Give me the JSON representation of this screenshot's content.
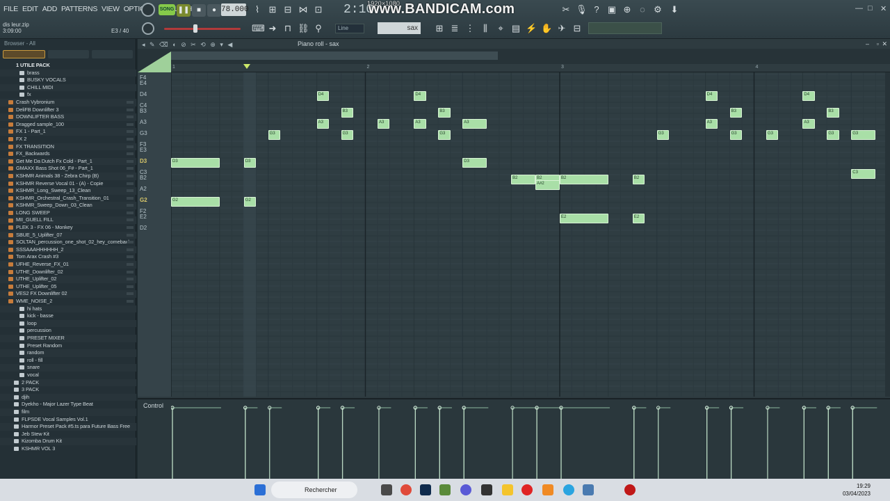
{
  "menu": [
    "FILE",
    "EDIT",
    "ADD",
    "PATTERNS",
    "VIEW",
    "OPTIONS",
    "TOOLS",
    "HELP"
  ],
  "transport": {
    "song_label": "SONG",
    "tempo": "78.000",
    "time": "2:10",
    "watermark": "www.BANDICAM.com",
    "resolution": "1920×1080"
  },
  "hint": {
    "file": "dis leur.zip",
    "time": "3:09:00",
    "position": "E3 / 40"
  },
  "snap": "Line",
  "instrument": "sax",
  "browser": {
    "title": "Browser - All",
    "items": [
      {
        "label": "1 UTILE PACK",
        "kind": "pack"
      },
      {
        "label": "brass",
        "kind": "folder",
        "indent": 2
      },
      {
        "label": "BUSKY VOCALS",
        "kind": "folder",
        "indent": 2
      },
      {
        "label": "CHILL MIDI",
        "kind": "folder",
        "indent": 2
      },
      {
        "label": "fx",
        "kind": "folder",
        "indent": 2
      },
      {
        "label": "Crash Vybronium",
        "kind": "file"
      },
      {
        "label": "DeliFB Downlifter 3",
        "kind": "file"
      },
      {
        "label": "DOWNLIFTER BASS",
        "kind": "file"
      },
      {
        "label": "Dragged sample_100",
        "kind": "file"
      },
      {
        "label": "FX 1 - Part_1",
        "kind": "file"
      },
      {
        "label": "FX 2",
        "kind": "file"
      },
      {
        "label": "FX TRANSITION",
        "kind": "file"
      },
      {
        "label": "FX_Backwards",
        "kind": "file"
      },
      {
        "label": "Get Me Da Dutch Fx Cold - Part_1",
        "kind": "file"
      },
      {
        "label": "GMAXX Bass Shot 06_F# - Part_1",
        "kind": "file"
      },
      {
        "label": "KSHMR Animals 38 - Zebra Chirp (B)",
        "kind": "file"
      },
      {
        "label": "KSHMR Reverse Vocal 01 - (A) - Copie",
        "kind": "file"
      },
      {
        "label": "KSHMR_Long_Sweep_13_Clean",
        "kind": "file",
        "selected": true
      },
      {
        "label": "KSHMR_Orchestral_Crash_Transition_01",
        "kind": "file"
      },
      {
        "label": "KSHMR_Sweep_Down_03_Clean",
        "kind": "file"
      },
      {
        "label": "LONG SWEEP",
        "kind": "file"
      },
      {
        "label": "MII_GUELL FILL",
        "kind": "file"
      },
      {
        "label": "PLEK 3 - FX 06 - Monkey",
        "kind": "file"
      },
      {
        "label": "SBUE_5_Uplifter_07",
        "kind": "file"
      },
      {
        "label": "SOLTAN_percussion_one_shot_02_hey_comeback",
        "kind": "file"
      },
      {
        "label": "SSSAAAHHHHHH_2",
        "kind": "file"
      },
      {
        "label": "Tom Arax Crash #3",
        "kind": "file"
      },
      {
        "label": "UFHE_Reverse_FX_01",
        "kind": "file"
      },
      {
        "label": "UTHE_Downlifter_02",
        "kind": "file"
      },
      {
        "label": "UTHE_Uplifter_02",
        "kind": "file"
      },
      {
        "label": "UTHE_Uplifter_05",
        "kind": "file"
      },
      {
        "label": "VES2 FX Downlifter 02",
        "kind": "file"
      },
      {
        "label": "WME_NOISE_2",
        "kind": "file"
      },
      {
        "label": "hi hats",
        "kind": "folder",
        "indent": 2
      },
      {
        "label": "kick - basse",
        "kind": "folder",
        "indent": 2
      },
      {
        "label": "loop",
        "kind": "folder",
        "indent": 2
      },
      {
        "label": "percussion",
        "kind": "folder",
        "indent": 2
      },
      {
        "label": "PRESET MIXER",
        "kind": "folder",
        "indent": 2
      },
      {
        "label": "Preset Random",
        "kind": "folder",
        "indent": 2
      },
      {
        "label": "random",
        "kind": "folder",
        "indent": 2
      },
      {
        "label": "roll - fill",
        "kind": "folder",
        "indent": 2
      },
      {
        "label": "snare",
        "kind": "folder",
        "indent": 2
      },
      {
        "label": "vocal",
        "kind": "folder",
        "indent": 2
      },
      {
        "label": "2 PACK",
        "kind": "folder",
        "indent": 1
      },
      {
        "label": "3 PACK",
        "kind": "folder",
        "indent": 1
      },
      {
        "label": "djih",
        "kind": "folder",
        "indent": 1
      },
      {
        "label": "Dyekho - Major Lazer Type Beat",
        "kind": "folder",
        "indent": 1
      },
      {
        "label": "film",
        "kind": "folder",
        "indent": 1
      },
      {
        "label": "FLPSDE Vocal Samples Vol.1",
        "kind": "folder",
        "indent": 1
      },
      {
        "label": "Harmor Preset Pack #5.ts para Future Bass Free",
        "kind": "folder",
        "indent": 1
      },
      {
        "label": "Jeb Stew Kit",
        "kind": "folder",
        "indent": 1
      },
      {
        "label": "Kizomba Drum Kit",
        "kind": "folder",
        "indent": 1
      },
      {
        "label": "KSHMR VOL 3",
        "kind": "folder",
        "indent": 1
      }
    ]
  },
  "piano_roll": {
    "title": "Piano roll - sax",
    "bars": [
      "1",
      "2",
      "3",
      "4"
    ],
    "keys": [
      {
        "name": "F4"
      },
      {
        "name": "E4"
      },
      {
        "name": "D4"
      },
      {
        "name": "C4"
      },
      {
        "name": "B3"
      },
      {
        "name": "A3"
      },
      {
        "name": "G3"
      },
      {
        "name": "F3"
      },
      {
        "name": "E3"
      },
      {
        "name": "D3",
        "highlight": true
      },
      {
        "name": "C3"
      },
      {
        "name": "B2"
      },
      {
        "name": "A2"
      },
      {
        "name": "G2",
        "highlight": true
      },
      {
        "name": "F2"
      },
      {
        "name": "E2"
      },
      {
        "name": "D2"
      }
    ],
    "notes": [
      {
        "pitch": "D3",
        "start": 1.0,
        "length": 0.25
      },
      {
        "pitch": "G2",
        "start": 1.0,
        "length": 0.25
      },
      {
        "pitch": "D3",
        "start": 1.375,
        "length": 0.0625
      },
      {
        "pitch": "G2",
        "start": 1.375,
        "length": 0.0625
      },
      {
        "pitch": "G3",
        "start": 1.5,
        "length": 0.0625
      },
      {
        "pitch": "A3",
        "start": 1.75,
        "length": 0.0625
      },
      {
        "pitch": "D4",
        "start": 1.75,
        "length": 0.0625
      },
      {
        "pitch": "B3",
        "start": 1.875,
        "length": 0.0625
      },
      {
        "pitch": "G3",
        "start": 1.875,
        "length": 0.0625
      },
      {
        "pitch": "A3",
        "start": 2.0625,
        "length": 0.0625
      },
      {
        "pitch": "A3",
        "start": 2.25,
        "length": 0.0625
      },
      {
        "pitch": "D4",
        "start": 2.25,
        "length": 0.0625
      },
      {
        "pitch": "B3",
        "start": 2.375,
        "length": 0.0625
      },
      {
        "pitch": "G3",
        "start": 2.375,
        "length": 0.0625
      },
      {
        "pitch": "A3",
        "start": 2.5,
        "length": 0.125
      },
      {
        "pitch": "D3",
        "start": 2.5,
        "length": 0.125
      },
      {
        "pitch": "B2",
        "start": 2.75,
        "length": 0.125
      },
      {
        "pitch": "B2",
        "start": 2.875,
        "length": 0.125
      },
      {
        "pitch": "A#2",
        "start": 2.875,
        "length": 0.125
      },
      {
        "pitch": "B2",
        "start": 3.0,
        "length": 0.25
      },
      {
        "pitch": "E2",
        "start": 3.0,
        "length": 0.25
      },
      {
        "pitch": "B2",
        "start": 3.375,
        "length": 0.0625
      },
      {
        "pitch": "E2",
        "start": 3.375,
        "length": 0.0625
      },
      {
        "pitch": "G3",
        "start": 3.5,
        "length": 0.0625
      },
      {
        "pitch": "A3",
        "start": 3.75,
        "length": 0.0625
      },
      {
        "pitch": "D4",
        "start": 3.75,
        "length": 0.0625
      },
      {
        "pitch": "B3",
        "start": 3.875,
        "length": 0.0625
      },
      {
        "pitch": "G3",
        "start": 3.875,
        "length": 0.0625
      },
      {
        "pitch": "G3",
        "start": 4.0625,
        "length": 0.0625
      },
      {
        "pitch": "A3",
        "start": 4.25,
        "length": 0.0625
      },
      {
        "pitch": "D4",
        "start": 4.25,
        "length": 0.0625
      },
      {
        "pitch": "B3",
        "start": 4.375,
        "length": 0.0625
      },
      {
        "pitch": "G3",
        "start": 4.375,
        "length": 0.0625
      },
      {
        "pitch": "G3",
        "start": 4.5,
        "length": 0.125
      },
      {
        "pitch": "C3",
        "start": 4.5,
        "length": 0.125
      }
    ]
  },
  "control": {
    "label": "Control"
  },
  "taskbar": {
    "search_label": "Rechercher",
    "time": "19:29",
    "date": "03/04/2023"
  },
  "colors": {
    "note": "#a9dfa7",
    "accent": "#86c94a",
    "watermark": "#ffffff"
  }
}
